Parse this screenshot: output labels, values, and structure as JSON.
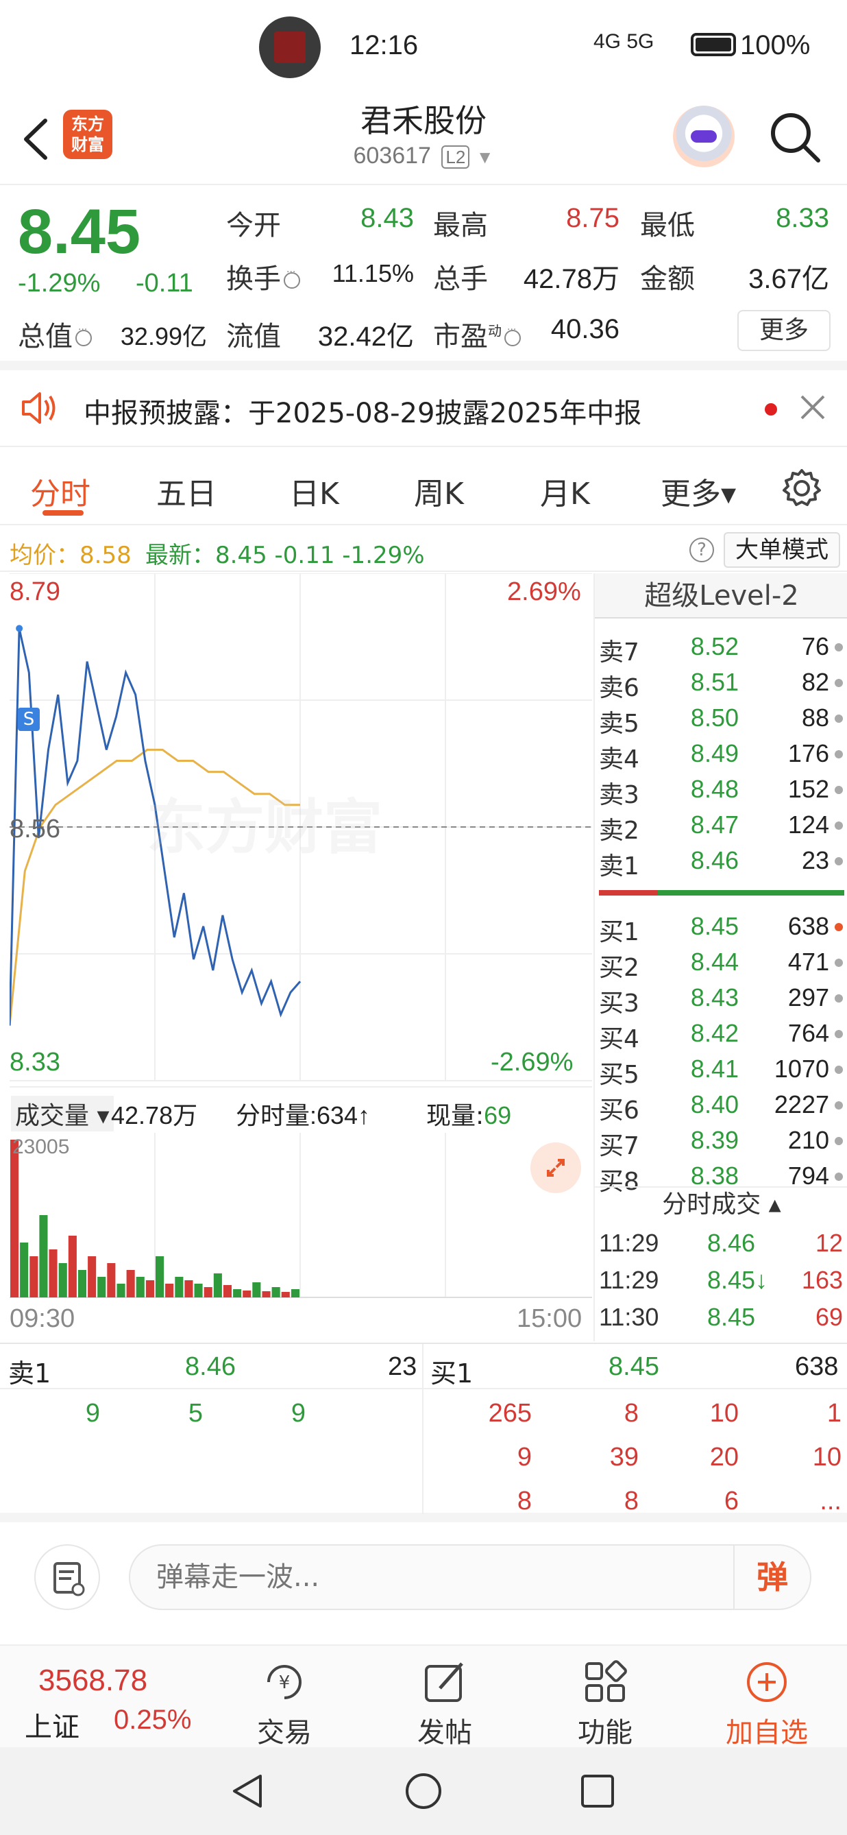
{
  "status_bar": {
    "time": "12:16",
    "signal": "4G  5G",
    "battery": "100%"
  },
  "header": {
    "title": "君禾股份",
    "code": "603617",
    "level": "L2",
    "logo_text": "东方\n财富"
  },
  "quote": {
    "price": "8.45",
    "change_pct": "-1.29%",
    "change_abs": "-0.11",
    "open_label": "今开",
    "open": "8.43",
    "high_label": "最高",
    "high": "8.75",
    "low_label": "最低",
    "low": "8.33",
    "turnover_label": "换手",
    "turnover": "11.15%",
    "volume_label": "总手",
    "volume": "42.78万",
    "amount_label": "金额",
    "amount": "3.67亿",
    "mktcap_label": "总值",
    "mktcap": "32.99亿",
    "float_label": "流值",
    "float": "32.42亿",
    "pe_label": "市盈",
    "pe_sup": "动",
    "pe": "40.36",
    "more": "更多"
  },
  "notice": {
    "text": "中报预披露：于2025-08-29披露2025年中报"
  },
  "tabs": [
    {
      "label": "分时",
      "active": true
    },
    {
      "label": "五日"
    },
    {
      "label": "日K"
    },
    {
      "label": "周K"
    },
    {
      "label": "月K"
    },
    {
      "label": "更多▾"
    }
  ],
  "avg_bar": {
    "avg_label": "均价：8.58",
    "latest_label": "最新：8.45  -0.11  -1.29%",
    "help": "?",
    "big_order_mode": "大单模式"
  },
  "chart": {
    "top_price": "8.79",
    "mid_price": "8.56",
    "bottom_price": "8.33",
    "top_pct": "2.69%",
    "bottom_pct": "-2.69%",
    "s_marker": "S",
    "watermark": "东方财富",
    "volume_label": "成交量 ▾",
    "volume_total": "42.78万",
    "minute_volume": "分时量:634↑",
    "current_volume_label": "现量:",
    "current_volume": "69",
    "volume_max": "23005",
    "time_start": "09:30",
    "time_end": "15:00"
  },
  "chart_data": {
    "type": "line",
    "ylim": [
      8.33,
      8.79
    ],
    "yticks": [
      "8.79",
      "8.56",
      "8.33"
    ],
    "x_range": [
      "09:30",
      "15:00"
    ],
    "series": [
      {
        "name": "price",
        "color": "#2f62b0",
        "values": [
          8.38,
          8.74,
          8.7,
          8.55,
          8.63,
          8.68,
          8.6,
          8.62,
          8.71,
          8.67,
          8.63,
          8.66,
          8.7,
          8.68,
          8.62,
          8.58,
          8.52,
          8.46,
          8.5,
          8.44,
          8.47,
          8.43,
          8.48,
          8.44,
          8.41,
          8.43,
          8.4,
          8.42,
          8.39,
          8.41,
          8.42
        ]
      },
      {
        "name": "avg",
        "color": "#e8b24a",
        "values": [
          8.38,
          8.52,
          8.56,
          8.58,
          8.59,
          8.6,
          8.61,
          8.62,
          8.62,
          8.63,
          8.63,
          8.62,
          8.62,
          8.61,
          8.61,
          8.6,
          8.59,
          8.59,
          8.58,
          8.58
        ]
      },
      {
        "name": "volume",
        "values": [
          23005,
          8000,
          6000,
          12000,
          7000,
          5000,
          9000,
          4000,
          6000,
          3000,
          5000,
          2000,
          4000,
          3000,
          2500,
          6000,
          2000,
          3000,
          2500,
          2000,
          1500,
          3500,
          1800,
          1200,
          1000,
          2200,
          900,
          1500,
          800,
          1200
        ]
      }
    ]
  },
  "book": {
    "title": "超级Level-2",
    "asks": [
      {
        "label": "卖7",
        "price": "8.52",
        "vol": "76"
      },
      {
        "label": "卖6",
        "price": "8.51",
        "vol": "82"
      },
      {
        "label": "卖5",
        "price": "8.50",
        "vol": "88"
      },
      {
        "label": "卖4",
        "price": "8.49",
        "vol": "176"
      },
      {
        "label": "卖3",
        "price": "8.48",
        "vol": "152"
      },
      {
        "label": "卖2",
        "price": "8.47",
        "vol": "124"
      },
      {
        "label": "卖1",
        "price": "8.46",
        "vol": "23"
      }
    ],
    "bids": [
      {
        "label": "买1",
        "price": "8.45",
        "vol": "638"
      },
      {
        "label": "买2",
        "price": "8.44",
        "vol": "471"
      },
      {
        "label": "买3",
        "price": "8.43",
        "vol": "297"
      },
      {
        "label": "买4",
        "price": "8.42",
        "vol": "764"
      },
      {
        "label": "买5",
        "price": "8.41",
        "vol": "1070"
      },
      {
        "label": "买6",
        "price": "8.40",
        "vol": "2227"
      },
      {
        "label": "买7",
        "price": "8.39",
        "vol": "210"
      },
      {
        "label": "买8",
        "price": "8.38",
        "vol": "794"
      }
    ],
    "trades_title": "分时成交 ▴",
    "trades": [
      {
        "time": "11:29",
        "price": "8.46",
        "vol": "12"
      },
      {
        "time": "11:29",
        "price": "8.45↓",
        "vol": "163"
      },
      {
        "time": "11:30",
        "price": "8.45",
        "vol": "69"
      }
    ]
  },
  "queue": {
    "sell_label": "卖1",
    "sell_price": "8.46",
    "sell_vol": "23",
    "buy_label": "买1",
    "buy_price": "8.45",
    "buy_vol": "638",
    "sell_orders": [
      "9",
      "5",
      "9"
    ],
    "buy_orders": [
      "265",
      "8",
      "10",
      "1",
      "9",
      "39",
      "20",
      "10",
      "8",
      "8",
      "6",
      "..."
    ]
  },
  "comment": {
    "placeholder": "弹幕走一波...",
    "danmu": "弹"
  },
  "bottom_nav": {
    "index_value": "3568.78",
    "index_name": "上证",
    "index_change": "0.25%",
    "items": [
      "交易",
      "发帖",
      "功能",
      "加自选"
    ]
  }
}
